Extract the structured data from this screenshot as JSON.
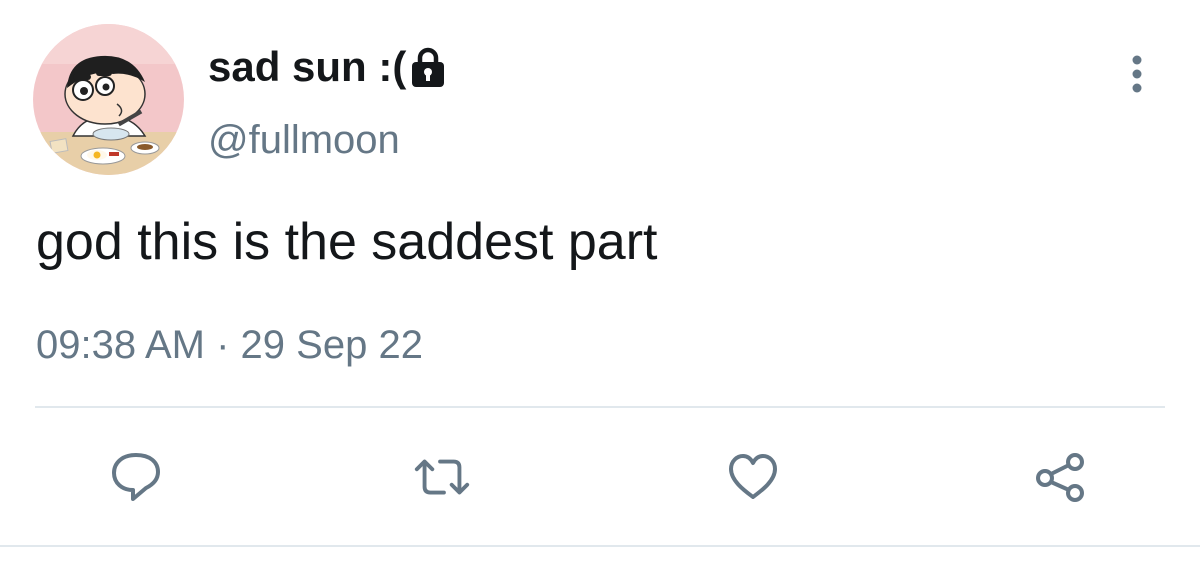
{
  "author": {
    "display_name": "sad sun :(",
    "handle": "@fullmoon",
    "protected": true
  },
  "tweet": {
    "text": "god this is the saddest part",
    "timestamp": "09:38 AM · 29 Sep 22"
  },
  "icons": {
    "avatar": "avatar-image",
    "lock": "lock-icon",
    "more": "more-icon",
    "reply": "reply-icon",
    "retweet": "retweet-icon",
    "like": "like-icon",
    "share": "share-icon"
  },
  "colors": {
    "text_primary": "#14171a",
    "text_secondary": "#657786",
    "divider": "#e1e8ed"
  }
}
